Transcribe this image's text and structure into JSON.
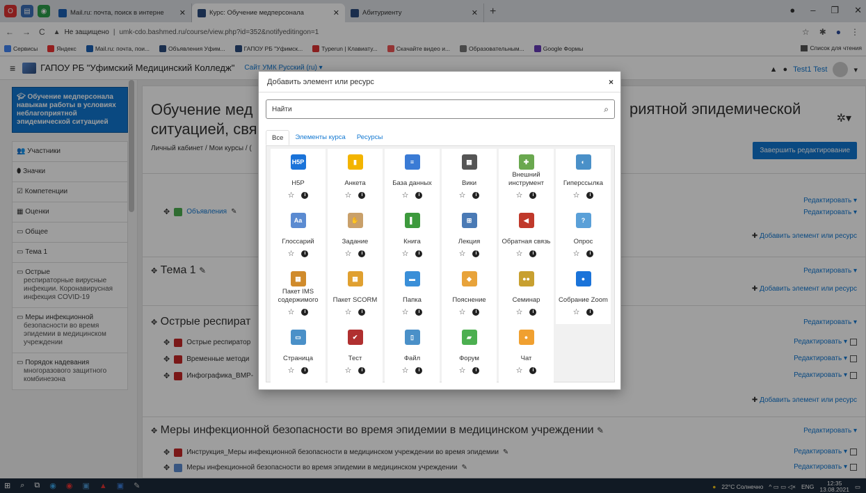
{
  "browser": {
    "tabs": [
      {
        "label": "Mail.ru: почта, поиск в интерне",
        "active": false
      },
      {
        "label": "Курс: Обучение медперсонала",
        "active": true
      },
      {
        "label": "Абитуриенту",
        "active": false
      }
    ],
    "new_tab": "+",
    "url_warning": "Не защищено",
    "url": "umk-cdo.bashmed.ru/course/view.php?id=352&notifyeditingon=1",
    "bookmarks": [
      "Сервисы",
      "Яндекс",
      "Mail.ru: почта, пои...",
      "Объявления Уфим...",
      "ГАПОУ РБ \"Уфимск...",
      "Typerun | Клавиату...",
      "Скачайте видео и...",
      "Образовательным...",
      "Google Формы"
    ],
    "reading_list": "Список для чтения"
  },
  "moodle": {
    "site_name": "ГАПОУ РБ \"Уфимский Медицинский Колледж\"",
    "site_menu": "Сайт УМК   Русский (ru) ▾",
    "user": "Test1 Test"
  },
  "nav": {
    "current": "Обучение медперсонала навыкам работы в условиях неблагоприятной эпидемической ситуацией",
    "items": [
      {
        "icon": "👥",
        "label": "Участники"
      },
      {
        "icon": "⬮",
        "label": "Значки"
      },
      {
        "icon": "☑",
        "label": "Компетенции"
      },
      {
        "icon": "▦",
        "label": "Оценки"
      },
      {
        "icon": "▭",
        "label": "Общее"
      },
      {
        "icon": "▭",
        "label": "Тема 1"
      },
      {
        "icon": "▭",
        "label": "Острые",
        "sub": "респираторные вирусные инфекции. Коронавирусная инфекция COVID-19"
      },
      {
        "icon": "▭",
        "label": "Меры инфекционной",
        "sub": "безопасности во время эпидемии в медицинском учреждении"
      },
      {
        "icon": "▭",
        "label": "Порядок надевания",
        "sub": "многоразового защитного комбинезона"
      }
    ]
  },
  "course": {
    "title_part1": "Обучение мед",
    "title_part2": "ситуацией, свя",
    "title_right": "риятной эпидемической",
    "breadcrumb": "Личный кабинет / Мои курсы / (",
    "finish_editing": "Завершить редактирование",
    "edit": "Редактировать ▾",
    "add_resource": "Добавить элемент или ресурс",
    "announcements": "Объявления",
    "topic1": "Тема 1",
    "sec2_title": "Острые респират",
    "sec2_items": [
      "Острые респиратор",
      "Временные методи",
      "Инфографика_ВМР-"
    ],
    "sec3_title": "Меры инфекционной безопасности во время эпидемии в медицинском учреждении",
    "sec3_items": [
      "Инструкция_Меры инфекционной безопасности в медицинском учреждении во время эпидемии",
      "Меры инфекционной безопасности во время эпидемии в медицинском учреждении"
    ]
  },
  "modal": {
    "title": "Добавить элемент или ресурс",
    "close": "×",
    "search_placeholder": "Найти",
    "tabs": [
      "Все",
      "Элементы курса",
      "Ресурсы"
    ],
    "items": [
      {
        "label": "H5P",
        "icon": "H5P",
        "color": "#1a73d9"
      },
      {
        "label": "Анкета",
        "icon": "▮",
        "color": "#f3b400"
      },
      {
        "label": "База данных",
        "icon": "≡",
        "color": "#3a7bd5"
      },
      {
        "label": "Вики",
        "icon": "▦",
        "color": "#555555"
      },
      {
        "label": "Внешний инструмент",
        "icon": "✚",
        "color": "#6aa84f"
      },
      {
        "label": "Гиперссылка",
        "icon": "◐",
        "color": "#4a90c8"
      },
      {
        "label": "Глоссарий",
        "icon": "Aa",
        "color": "#5b8bd1"
      },
      {
        "label": "Задание",
        "icon": "✋",
        "color": "#c9a06a"
      },
      {
        "label": "Книга",
        "icon": "▌",
        "color": "#3d9a3d"
      },
      {
        "label": "Лекция",
        "icon": "⊞",
        "color": "#4a7ab5"
      },
      {
        "label": "Обратная связь",
        "icon": "◀",
        "color": "#c0392b"
      },
      {
        "label": "Опрос",
        "icon": "?",
        "color": "#5aa0d8"
      },
      {
        "label": "Пакет IMS содержимого",
        "icon": "▦",
        "color": "#d08b2c"
      },
      {
        "label": "Пакет SCORM",
        "icon": "▦",
        "color": "#e0a030"
      },
      {
        "label": "Папка",
        "icon": "▬",
        "color": "#3a8fd8"
      },
      {
        "label": "Пояснение",
        "icon": "◆",
        "color": "#e8a33a"
      },
      {
        "label": "Семинар",
        "icon": "●●",
        "color": "#c8a030"
      },
      {
        "label": "Собрание Zoom",
        "icon": "●",
        "color": "#1a73d9"
      },
      {
        "label": "Страница",
        "icon": "▭",
        "color": "#4a90c8"
      },
      {
        "label": "Тест",
        "icon": "✔",
        "color": "#b03030"
      },
      {
        "label": "Файл",
        "icon": "▯",
        "color": "#4a90c8"
      },
      {
        "label": "Форум",
        "icon": "▰",
        "color": "#4caf50"
      },
      {
        "label": "Чат",
        "icon": "●",
        "color": "#f0a030"
      }
    ]
  },
  "taskbar": {
    "weather": "22°C Солнечно",
    "lang": "ENG",
    "time": "12:35",
    "date": "13.08.2021"
  }
}
